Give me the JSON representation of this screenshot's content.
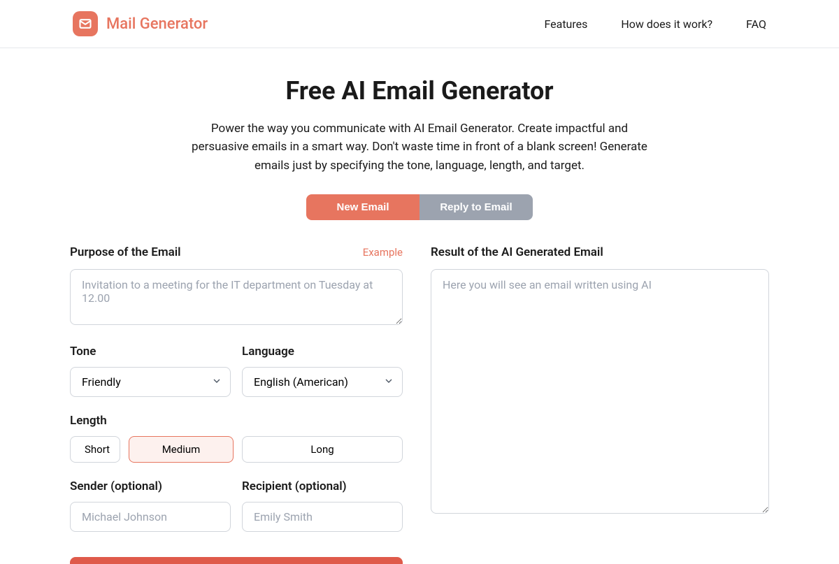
{
  "brand": {
    "name": "Mail Generator"
  },
  "nav": {
    "features": "Features",
    "how": "How does it work?",
    "faq": "FAQ"
  },
  "hero": {
    "title": "Free AI Email Generator",
    "subtitle": "Power the way you communicate with AI Email Generator. Create impactful and persuasive emails in a smart way. Don't waste time in front of a blank screen! Generate emails just by specifying the tone, language, length, and target."
  },
  "tabs": {
    "new": "New Email",
    "reply": "Reply to Email"
  },
  "form": {
    "purpose_label": "Purpose of the Email",
    "example": "Example",
    "purpose_placeholder": "Invitation to a meeting for the IT department on Tuesday at 12.00",
    "tone_label": "Tone",
    "tone_value": "Friendly",
    "language_label": "Language",
    "language_value": "English (American)",
    "length_label": "Length",
    "length_short": "Short",
    "length_medium": "Medium",
    "length_long": "Long",
    "sender_label": "Sender (optional)",
    "sender_placeholder": "Michael Johnson",
    "recipient_label": "Recipient (optional)",
    "recipient_placeholder": "Emily Smith"
  },
  "result": {
    "label": "Result of the AI Generated Email",
    "placeholder": "Here you will see an email written using AI"
  }
}
